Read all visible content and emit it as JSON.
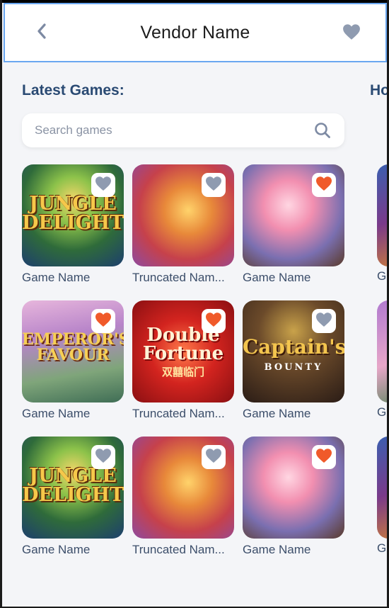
{
  "header": {
    "title": "Vendor Name"
  },
  "sections": {
    "latest_title": "Latest Games:",
    "next_title": "Ho"
  },
  "search": {
    "placeholder": "Search games"
  },
  "games": [
    {
      "name": "Game Name",
      "art": "jungle",
      "art_title": "JUNGLE DELIGHT",
      "favorited": false
    },
    {
      "name": "Truncated Nam...",
      "art": "monkey",
      "art_title": "",
      "favorited": false
    },
    {
      "name": "Game Name",
      "art": "girl",
      "art_title": "",
      "favorited": true
    },
    {
      "name": "Game Name",
      "art": "emperor",
      "art_title": "EMPEROR'S FAVOUR",
      "favorited": true
    },
    {
      "name": "Truncated Nam...",
      "art": "double",
      "art_title": "Double Fortune",
      "art_subtitle": "双囍临门",
      "favorited": true
    },
    {
      "name": "Game Name",
      "art": "captain",
      "art_title": "Captain's",
      "art_subtitle": "BOUNTY",
      "favorited": false
    },
    {
      "name": "Game Name",
      "art": "jungle",
      "art_title": "JUNGLE DELIGHT",
      "favorited": false
    },
    {
      "name": "Truncated Nam...",
      "art": "monkey",
      "art_title": "",
      "favorited": false
    },
    {
      "name": "Game Name",
      "art": "girl",
      "art_title": "",
      "favorited": true
    }
  ],
  "edge_labels": [
    "G",
    "G",
    "G"
  ],
  "colors": {
    "heart_active": "#f05a2a",
    "heart_inactive": "#8f9bb0",
    "accent_border": "#6aa7f0",
    "section_title": "#2a4a73"
  },
  "icons": {
    "back": "chevron-left-icon",
    "favorite": "heart-icon",
    "search": "search-icon"
  }
}
